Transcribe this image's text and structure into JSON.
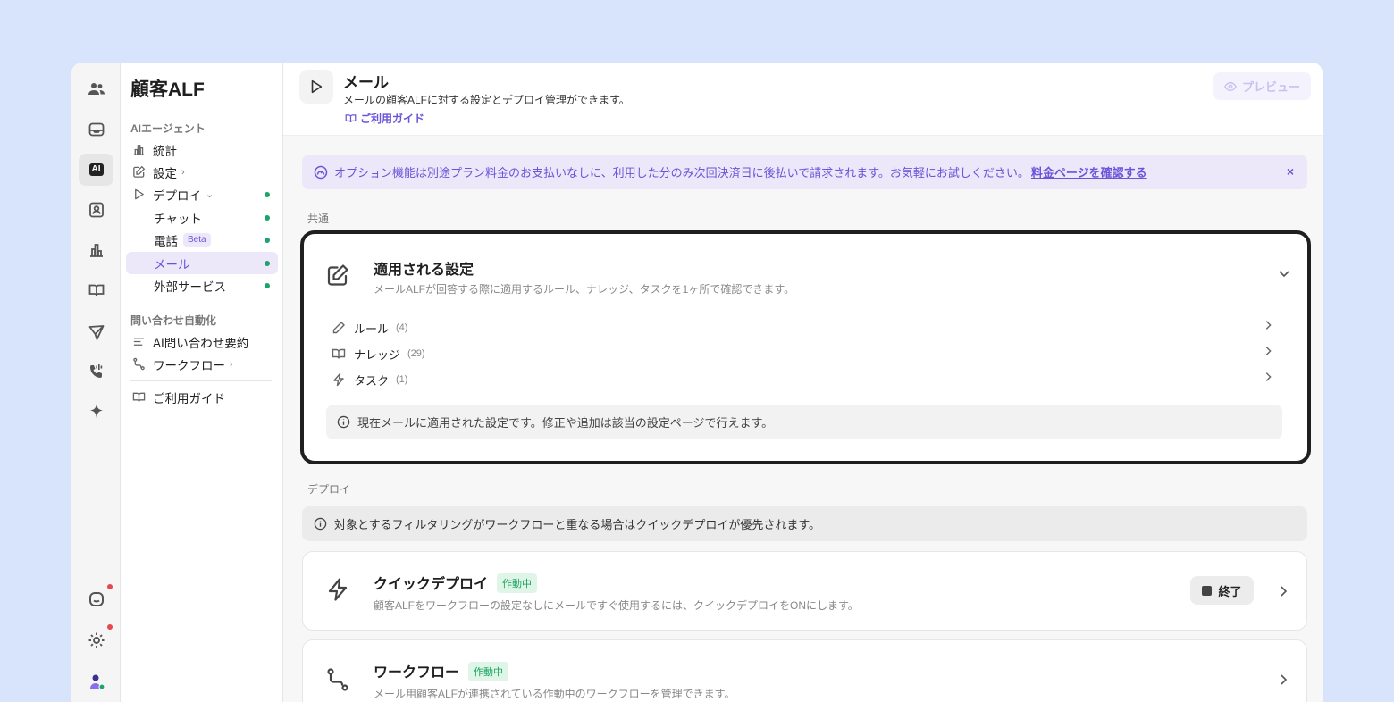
{
  "brand": "顧客ALF",
  "rail": {
    "ai_label": "AI"
  },
  "sidebar": {
    "section_ai": "AIエージェント",
    "stats": "統計",
    "settings": "設定",
    "deploy": "デプロイ",
    "chat": "チャット",
    "phone": "電話",
    "phone_badge": "Beta",
    "mail": "メール",
    "external": "外部サービス",
    "section_auto": "問い合わせ自動化",
    "summary": "AI問い合わせ要約",
    "workflow": "ワークフロー",
    "guide": "ご利用ガイド"
  },
  "header": {
    "title": "メール",
    "description": "メールの顧客ALFに対する設定とデプロイ管理ができます。",
    "guide": "ご利用ガイド",
    "preview": "プレビュー"
  },
  "banner": {
    "text": "オプション機能は別途プラン料金のお支払いなしに、利用した分のみ次回決済日に後払いで請求されます。お気軽にお試しください。",
    "link": "料金ページを確認する",
    "close": "×"
  },
  "common": {
    "label": "共通",
    "title": "適用される設定",
    "description": "メールALFが回答する際に適用するルール、ナレッジ、タスクを1ヶ所で確認できます。",
    "rows": [
      {
        "label": "ルール",
        "count": "(4)"
      },
      {
        "label": "ナレッジ",
        "count": "(29)"
      },
      {
        "label": "タスク",
        "count": "(1)"
      }
    ],
    "note": "現在メールに適用された設定です。修正や追加は該当の設定ページで行えます。"
  },
  "deploy": {
    "label": "デプロイ",
    "info": "対象とするフィルタリングがワークフローと重なる場合はクイックデプロイが優先されます。",
    "quick": {
      "title": "クイックデプロイ",
      "status": "作動中",
      "description": "顧客ALFをワークフローの設定なしにメールですぐ使用するには、クイックデプロイをONにします。",
      "button": "終了"
    },
    "workflow": {
      "title": "ワークフロー",
      "status": "作動中",
      "description": "メール用顧客ALFが連携されている作動中のワークフローを管理できます。"
    }
  }
}
